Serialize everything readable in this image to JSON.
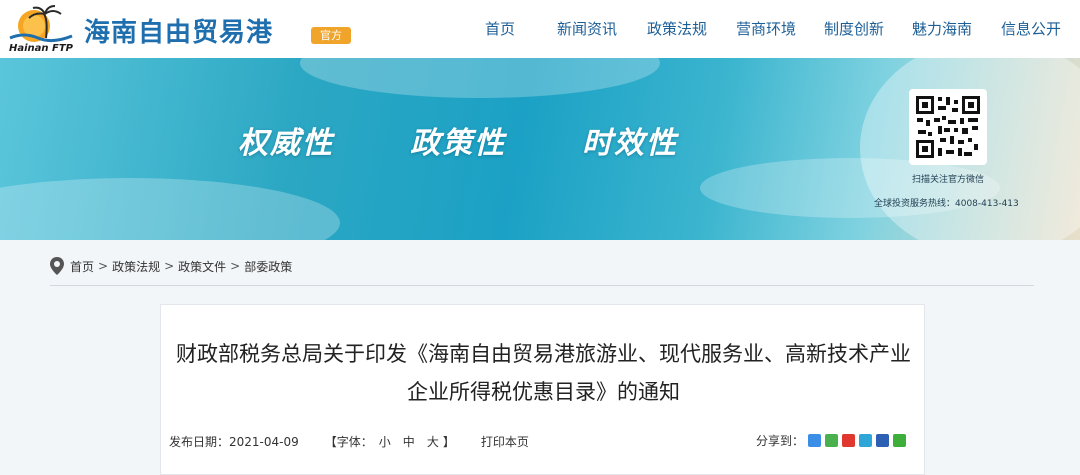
{
  "header": {
    "logo_text": "Hainan FTP",
    "site_title": "海南自由贸易港",
    "official_tag": "官方",
    "nav": [
      "首页",
      "新闻资讯",
      "政策法规",
      "营商环境",
      "制度创新",
      "魅力海南",
      "信息公开"
    ]
  },
  "banner": {
    "slogans": [
      "权威性",
      "政策性",
      "时效性"
    ],
    "qr_caption": "扫描关注官方微信",
    "hotline": "全球投资服务热线：4008-413-413"
  },
  "breadcrumb": [
    "首页",
    "政策法规",
    "政策文件",
    "部委政策"
  ],
  "article": {
    "title_line1": "财政部税务总局关于印发《海南自由贸易港旅游业、现代服务业、高新技术产业",
    "title_line2": "企业所得税优惠目录》的通知",
    "publish_label": "发布日期：",
    "publish_date": "2021-04-09",
    "font_label": "【字体：",
    "font_small": "小",
    "font_medium": "中",
    "font_large": "大",
    "font_close": "】",
    "print_label": "打印本页",
    "share_label": "分享到："
  },
  "colors": {
    "brand_blue": "#1f6fae",
    "nav_blue": "#1d5f97",
    "tag_orange": "#f0a52a"
  },
  "icons": {
    "breadcrumb": "location-pin-icon",
    "share": [
      "qzone-icon",
      "tencent-weibo-icon",
      "sina-weibo-icon",
      "tencent-qq-icon",
      "renren-icon",
      "wechat-icon"
    ]
  }
}
